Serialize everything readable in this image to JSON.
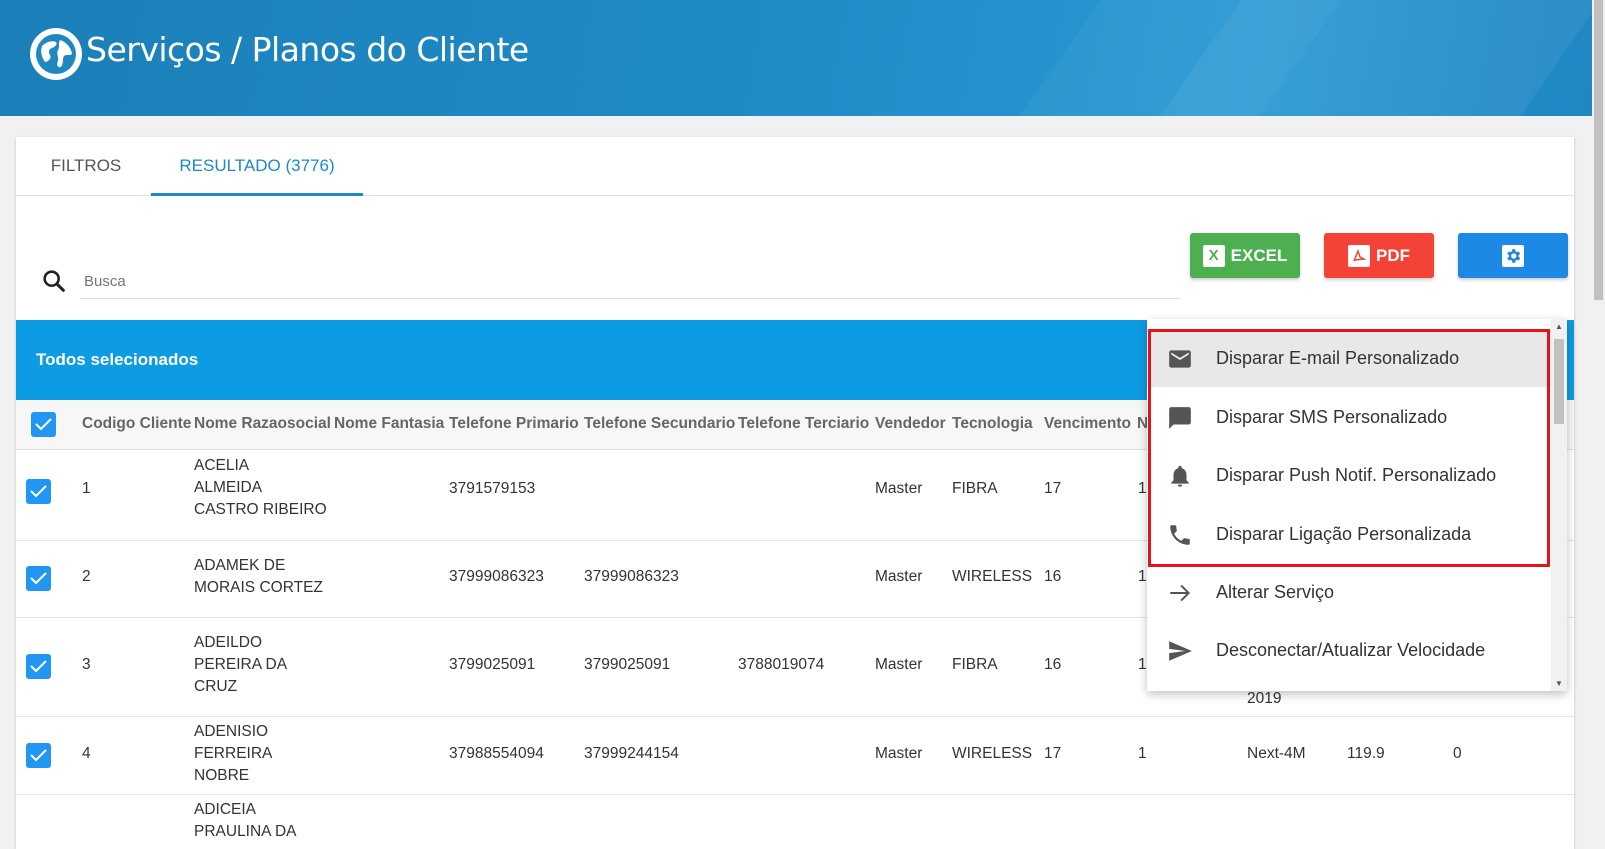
{
  "header": {
    "title": "Serviços / Planos do Cliente"
  },
  "tabs": [
    {
      "label": "FILTROS"
    },
    {
      "label": "RESULTADO (3776)"
    }
  ],
  "search": {
    "placeholder": "Busca"
  },
  "buttons": {
    "excel": "EXCEL",
    "pdf": "PDF",
    "settings_icon": "gear-icon"
  },
  "selection": {
    "label": "Todos selecionados"
  },
  "columns": [
    "Codigo Cliente",
    "Nome Razaosocial",
    "Nome Fantasia",
    "Telefone Primario",
    "Telefone Secundario",
    "Telefone Terciario",
    "Vendedor",
    "Tecnologia",
    "Vencimento",
    "N"
  ],
  "rows": [
    {
      "codigo": "1",
      "nome": [
        "ACELIA",
        "ALMEIDA",
        "CASTRO RIBEIRO"
      ],
      "tel1": "3791579153",
      "tel2": "",
      "tel3": "",
      "vendedor": "Master",
      "tecnologia": "FIBRA",
      "vencimento": "17",
      "n": "1",
      "extra1": "",
      "extra2": "",
      "extra3": ""
    },
    {
      "codigo": "2",
      "nome": [
        "ADAMEK DE",
        "MORAIS CORTEZ"
      ],
      "tel1": "37999086323",
      "tel2": "37999086323",
      "tel3": "",
      "vendedor": "Master",
      "tecnologia": "WIRELESS",
      "vencimento": "16",
      "n": "1",
      "extra1": "",
      "extra2": "",
      "extra3": ""
    },
    {
      "codigo": "3",
      "nome": [
        "ADEILDO",
        "PEREIRA DA",
        "CRUZ"
      ],
      "tel1": "3799025091",
      "tel2": "3799025091",
      "tel3": "3788019074",
      "vendedor": "Master",
      "tecnologia": "FIBRA",
      "vencimento": "16",
      "n": "1",
      "extra1": "2019",
      "extra2": "",
      "extra3": ""
    },
    {
      "codigo": "4",
      "nome": [
        "ADENISIO",
        "FERREIRA",
        "NOBRE"
      ],
      "tel1": "37988554094",
      "tel2": "37999244154",
      "tel3": "",
      "vendedor": "Master",
      "tecnologia": "WIRELESS",
      "vencimento": "17",
      "n": "1",
      "extra1": "Next-4M",
      "extra2": "119.9",
      "extra3": "0"
    },
    {
      "codigo": "",
      "nome": [
        "ADICEIA",
        "PRAULINA DA"
      ],
      "tel1": "",
      "tel2": "",
      "tel3": "",
      "vendedor": "",
      "tecnologia": "",
      "vencimento": "",
      "n": "",
      "extra1": "",
      "extra2": "",
      "extra3": ""
    }
  ],
  "menu": {
    "items": [
      {
        "label": "Disparar E-mail Personalizado",
        "icon": "email-icon"
      },
      {
        "label": "Disparar SMS Personalizado",
        "icon": "sms-icon"
      },
      {
        "label": "Disparar Push Notif. Personalizado",
        "icon": "bell-icon"
      },
      {
        "label": "Disparar Ligação Personalizada",
        "icon": "phone-icon"
      },
      {
        "label": "Alterar Serviço",
        "icon": "arrow-right-icon"
      },
      {
        "label": "Desconectar/Atualizar Velocidade",
        "icon": "send-icon"
      }
    ],
    "highlight_color": "#e3141a"
  },
  "colors": {
    "primary": "#1e88c9",
    "selection_bar": "#0d9be3",
    "checkbox": "#2196f3",
    "excel": "#4caf50",
    "pdf": "#f44336",
    "settings": "#1e88e5"
  }
}
